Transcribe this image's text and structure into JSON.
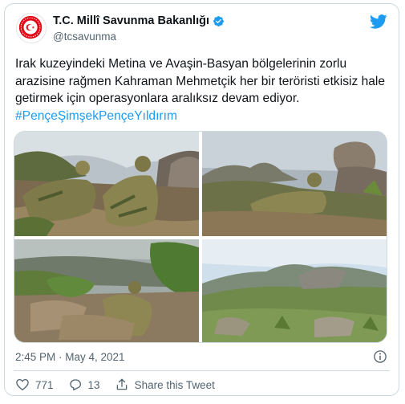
{
  "tweet": {
    "author_name": "T.C. Millî Savunma Bakanlığı",
    "author_handle": "@tcsavunma",
    "text_plain": "Irak kuzeyindeki Metina ve Avaşin-Basyan bölgelerinin zorlu arazisine rağmen Kahraman Mehmetçik her bir teröristi etkisiz hale getirmek için operasyonlara aralıksız devam ediyor. ",
    "hashtag": "#PençeŞimşekPençeYıldırım",
    "timestamp": "2:45 PM · May 4, 2021",
    "likes": "771",
    "replies": "13",
    "share_label": "Share this Tweet"
  },
  "icons": {
    "avatar": "ministry-emblem-icon",
    "verified": "verified-badge-icon",
    "brand": "twitter-bird-icon",
    "info": "info-icon",
    "like": "heart-icon",
    "reply": "reply-icon",
    "share": "share-icon"
  },
  "colors": {
    "accent": "#1d9bf0",
    "text": "#0f1419",
    "muted": "#536471",
    "border": "#cfd9de",
    "emblem_red": "#e30a17"
  }
}
